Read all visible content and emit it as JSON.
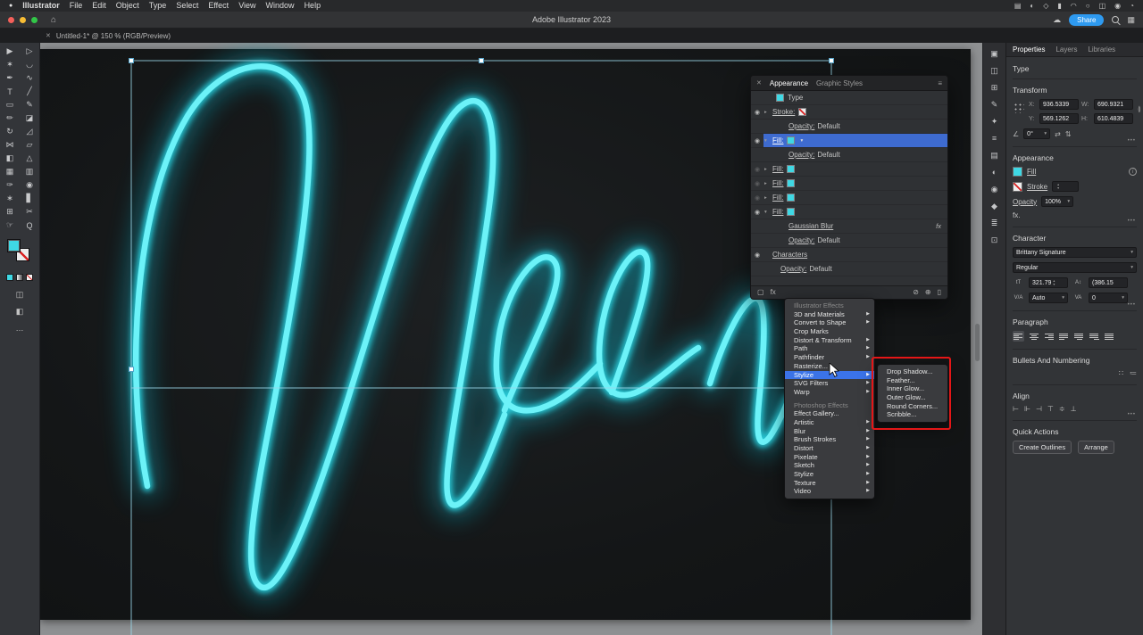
{
  "colors": {
    "neon_core": "#6cf2f8",
    "neon_mid": "#2bd9e7",
    "neon_glow": "#12b7cc",
    "accent_blue": "#3b73e8",
    "selection_blue": "#9bd8ea",
    "swatch_cyan": "#3fd8e4",
    "share_button": "#2e9af0",
    "annotation_red": "#e41617"
  },
  "icons": {
    "apple": "●",
    "home": "⌂",
    "cloud": "☁",
    "workspace-grid": "▦",
    "close": "✕",
    "hamburger": "≡",
    "chevron-down": "▾",
    "chevron-right": "▸",
    "submenu-arrow": "▶",
    "eye": "◉",
    "more": "•••",
    "angle": "∠",
    "flip-h": "⇄",
    "flip-v": "⇅",
    "link": "≬",
    "type-size": "tT",
    "leading": "A↕",
    "kerning": "V/A",
    "tracking": "VA",
    "info": "i",
    "fx": "fx",
    "draw-modes": "◫",
    "screen-mode": "◧",
    "ellipsis": "…",
    "stepper-up": "▴",
    "stepper-down": "▾"
  },
  "menubar": {
    "items": [
      "Illustrator",
      "File",
      "Edit",
      "Object",
      "Type",
      "Select",
      "Effect",
      "View",
      "Window",
      "Help"
    ],
    "status_icons": [
      {
        "name": "keyboard-icon",
        "glyph": "▤"
      },
      {
        "name": "do-not-disturb-icon",
        "glyph": "◐"
      },
      {
        "name": "display-icon",
        "glyph": "◇"
      },
      {
        "name": "battery-icon",
        "glyph": "▮"
      },
      {
        "name": "wifi-icon",
        "glyph": "◠"
      },
      {
        "name": "spotlight-search-icon",
        "glyph": "○"
      },
      {
        "name": "control-center-icon",
        "glyph": "◫"
      },
      {
        "name": "siri-icon",
        "glyph": "◉"
      },
      {
        "name": "clock-icon",
        "glyph": "◔"
      }
    ]
  },
  "titlebar": {
    "title": "Adobe Illustrator 2023",
    "share": "Share"
  },
  "tabbar": {
    "close": "✕",
    "title": "Untitled-1* @ 150 % (RGB/Preview)"
  },
  "tools": [
    {
      "name": "selection-tool",
      "glyph": "▶"
    },
    {
      "name": "direct-selection-tool",
      "glyph": "▷"
    },
    {
      "name": "magic-wand-tool",
      "glyph": "✶"
    },
    {
      "name": "lasso-tool",
      "glyph": "◡"
    },
    {
      "name": "pen-tool",
      "glyph": "✒"
    },
    {
      "name": "curvature-tool",
      "glyph": "∿"
    },
    {
      "name": "type-tool",
      "glyph": "T"
    },
    {
      "name": "line-segment-tool",
      "glyph": "╱"
    },
    {
      "name": "rectangle-tool",
      "glyph": "▭"
    },
    {
      "name": "paintbrush-tool",
      "glyph": "✎"
    },
    {
      "name": "shaper-tool",
      "glyph": "✏"
    },
    {
      "name": "eraser-tool",
      "glyph": "◪"
    },
    {
      "name": "rotate-tool",
      "glyph": "↻"
    },
    {
      "name": "scale-tool",
      "glyph": "◿"
    },
    {
      "name": "width-tool",
      "glyph": "⋈"
    },
    {
      "name": "free-transform-tool",
      "glyph": "▱"
    },
    {
      "name": "shape-builder-tool",
      "glyph": "◧"
    },
    {
      "name": "perspective-grid-tool",
      "glyph": "△"
    },
    {
      "name": "mesh-tool",
      "glyph": "▦"
    },
    {
      "name": "gradient-tool",
      "glyph": "▥"
    },
    {
      "name": "eyedropper-tool",
      "glyph": "✑"
    },
    {
      "name": "blend-tool",
      "glyph": "◉"
    },
    {
      "name": "symbol-sprayer-tool",
      "glyph": "∗"
    },
    {
      "name": "column-graph-tool",
      "glyph": "▋"
    },
    {
      "name": "artboard-tool",
      "glyph": "⊞"
    },
    {
      "name": "slice-tool",
      "glyph": "✂"
    },
    {
      "name": "hand-tool",
      "glyph": "☞"
    },
    {
      "name": "zoom-tool",
      "glyph": "Q"
    }
  ],
  "dock_icons": [
    {
      "name": "color-panel-icon",
      "glyph": "▣"
    },
    {
      "name": "color-guide-panel-icon",
      "glyph": "◫"
    },
    {
      "name": "swatches-panel-icon",
      "glyph": "⊞"
    },
    {
      "name": "brushes-panel-icon",
      "glyph": "✎"
    },
    {
      "name": "symbols-panel-icon",
      "glyph": "✦"
    },
    {
      "name": "stroke-panel-icon",
      "glyph": "≡"
    },
    {
      "name": "gradient-panel-icon",
      "glyph": "▤"
    },
    {
      "name": "transparency-panel-icon",
      "glyph": "◐"
    },
    {
      "name": "appearance-panel-icon",
      "glyph": "◉"
    },
    {
      "name": "graphic-styles-panel-icon",
      "glyph": "◆"
    },
    {
      "name": "layers-panel-icon",
      "glyph": "≣"
    },
    {
      "name": "artboards-panel-icon",
      "glyph": "⊡"
    }
  ],
  "appearance_panel": {
    "close": "✕",
    "tabs": [
      "Appearance",
      "Graphic Styles"
    ],
    "rows": [
      {
        "label": "Type",
        "swatch": "cyan",
        "swatchFirst": true,
        "indent": 0
      },
      {
        "label": "Stroke:",
        "eye": true,
        "chev": "▸",
        "swatch": "none",
        "underline": true,
        "indent": 0
      },
      {
        "label": "Opacity:",
        "value": "Default",
        "underline": true,
        "indent": 2
      },
      {
        "label": "Fill:",
        "eye": true,
        "chev": "▾",
        "swatch": "cyan",
        "dropdown": true,
        "selected": true,
        "underline": true,
        "indent": 0
      },
      {
        "label": "Opacity:",
        "value": "Default",
        "underline": true,
        "indent": 2
      },
      {
        "label": "Fill:",
        "eye": true,
        "dim": true,
        "chev": "▸",
        "swatch": "cyan",
        "underline": true,
        "indent": 0
      },
      {
        "label": "Fill:",
        "eye": true,
        "dim": true,
        "chev": "▸",
        "swatch": "cyan",
        "underline": true,
        "indent": 0
      },
      {
        "label": "Fill:",
        "eye": true,
        "dim": true,
        "chev": "▸",
        "swatch": "cyan",
        "underline": true,
        "indent": 0
      },
      {
        "label": "Fill:",
        "eye": true,
        "chev": "▾",
        "swatch": "cyan",
        "underline": true,
        "indent": 0
      },
      {
        "label": "Gaussian Blur",
        "underline": true,
        "fx": true,
        "indent": 2
      },
      {
        "label": "Opacity:",
        "value": "Default",
        "underline": true,
        "indent": 2
      },
      {
        "label": "Characters",
        "eye": true,
        "underline": true,
        "indent": 0
      },
      {
        "label": "Opacity:",
        "value": "Default",
        "underline": true,
        "indent": 1
      }
    ],
    "footer_left": [
      {
        "name": "add-new-stroke-icon",
        "glyph": "▢"
      },
      {
        "name": "add-new-effect-fx-icon",
        "glyph": "fx"
      }
    ],
    "footer_right": [
      {
        "name": "clear-appearance-icon",
        "glyph": "⊘"
      },
      {
        "name": "duplicate-selected-item-icon",
        "glyph": "⊕"
      },
      {
        "name": "delete-selected-item-icon",
        "glyph": "▯"
      }
    ]
  },
  "effect_menu": {
    "items": [
      {
        "label": "Illustrator Effects",
        "kind": "header"
      },
      {
        "label": "3D and Materials",
        "arrow": true
      },
      {
        "label": "Convert to Shape",
        "arrow": true
      },
      {
        "label": "Crop Marks"
      },
      {
        "label": "Distort & Transform",
        "arrow": true
      },
      {
        "label": "Path",
        "arrow": true
      },
      {
        "label": "Pathfinder",
        "arrow": true
      },
      {
        "label": "Rasterize..."
      },
      {
        "label": "Stylize",
        "arrow": true,
        "highlighted": true
      },
      {
        "label": "SVG Filters",
        "arrow": true
      },
      {
        "label": "Warp",
        "arrow": true
      },
      {
        "label": "Photoshop Effects",
        "kind": "header",
        "gap": true
      },
      {
        "label": "Effect Gallery..."
      },
      {
        "label": "Artistic",
        "arrow": true
      },
      {
        "label": "Blur",
        "arrow": true
      },
      {
        "label": "Brush Strokes",
        "arrow": true
      },
      {
        "label": "Distort",
        "arrow": true
      },
      {
        "label": "Pixelate",
        "arrow": true
      },
      {
        "label": "Sketch",
        "arrow": true
      },
      {
        "label": "Stylize",
        "arrow": true
      },
      {
        "label": "Texture",
        "arrow": true
      },
      {
        "label": "Video",
        "arrow": true
      }
    ]
  },
  "stylize_submenu": {
    "items": [
      "Drop Shadow...",
      "Feather...",
      "Inner Glow...",
      "Outer Glow...",
      "Round Corners...",
      "Scribble..."
    ]
  },
  "properties": {
    "tabs": [
      "Properties",
      "Layers",
      "Libraries"
    ],
    "object_type": "Type",
    "transform": {
      "header": "Transform",
      "fields": [
        {
          "label": "X:",
          "value": "936.5339"
        },
        {
          "label": "W:",
          "value": "690.9321"
        },
        {
          "label": "Y:",
          "value": "569.1262"
        },
        {
          "label": "H:",
          "value": "610.4839"
        }
      ],
      "angle": "0°"
    },
    "appearance": {
      "header": "Appearance",
      "fill_label": "Fill",
      "stroke_label": "Stroke",
      "opacity_label": "Opacity",
      "opacity_value": "100%",
      "fx_label": "fx."
    },
    "character": {
      "header": "Character",
      "font": "Brittany Signature",
      "style": "Regular",
      "size": "321.79",
      "leading": "(386.15",
      "kerning": "Auto",
      "tracking": "0"
    },
    "paragraph": {
      "header": "Paragraph",
      "aligns": [
        "align-left",
        "align-center",
        "align-right",
        "justify-last-left",
        "justify-last-center",
        "justify-last-right",
        "justify-all"
      ]
    },
    "bullets": {
      "header": "Bullets And Numbering",
      "icons": [
        {
          "name": "bulleted-list-icon",
          "glyph": "∷"
        },
        {
          "name": "numbered-list-icon",
          "glyph": "≔"
        }
      ]
    },
    "align": {
      "header": "Align",
      "icons": [
        {
          "name": "horizontal-align-left-icon",
          "glyph": "⊢"
        },
        {
          "name": "horizontal-align-center-icon",
          "glyph": "⊩"
        },
        {
          "name": "horizontal-align-right-icon",
          "glyph": "⊣"
        },
        {
          "name": "vertical-align-top-icon",
          "glyph": "⊤"
        },
        {
          "name": "vertical-align-center-icon",
          "glyph": "≑"
        },
        {
          "name": "vertical-align-bottom-icon",
          "glyph": "⊥"
        }
      ]
    },
    "quick_actions": {
      "header": "Quick Actions",
      "buttons": [
        "Create Outlines",
        "Arrange"
      ]
    }
  }
}
